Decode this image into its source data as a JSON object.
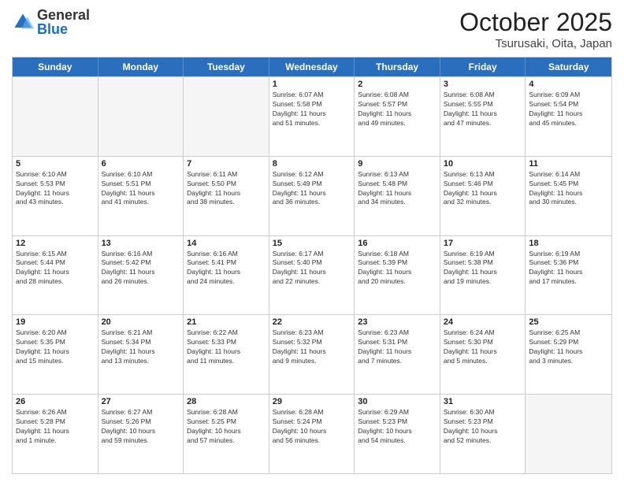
{
  "logo": {
    "general": "General",
    "blue": "Blue"
  },
  "title": "October 2025",
  "location": "Tsurusaki, Oita, Japan",
  "days": [
    "Sunday",
    "Monday",
    "Tuesday",
    "Wednesday",
    "Thursday",
    "Friday",
    "Saturday"
  ],
  "weeks": [
    [
      {
        "day": "",
        "info": ""
      },
      {
        "day": "",
        "info": ""
      },
      {
        "day": "",
        "info": ""
      },
      {
        "day": "1",
        "info": "Sunrise: 6:07 AM\nSunset: 5:58 PM\nDaylight: 11 hours\nand 51 minutes."
      },
      {
        "day": "2",
        "info": "Sunrise: 6:08 AM\nSunset: 5:57 PM\nDaylight: 11 hours\nand 49 minutes."
      },
      {
        "day": "3",
        "info": "Sunrise: 6:08 AM\nSunset: 5:55 PM\nDaylight: 11 hours\nand 47 minutes."
      },
      {
        "day": "4",
        "info": "Sunrise: 6:09 AM\nSunset: 5:54 PM\nDaylight: 11 hours\nand 45 minutes."
      }
    ],
    [
      {
        "day": "5",
        "info": "Sunrise: 6:10 AM\nSunset: 5:53 PM\nDaylight: 11 hours\nand 43 minutes."
      },
      {
        "day": "6",
        "info": "Sunrise: 6:10 AM\nSunset: 5:51 PM\nDaylight: 11 hours\nand 41 minutes."
      },
      {
        "day": "7",
        "info": "Sunrise: 6:11 AM\nSunset: 5:50 PM\nDaylight: 11 hours\nand 38 minutes."
      },
      {
        "day": "8",
        "info": "Sunrise: 6:12 AM\nSunset: 5:49 PM\nDaylight: 11 hours\nand 36 minutes."
      },
      {
        "day": "9",
        "info": "Sunrise: 6:13 AM\nSunset: 5:48 PM\nDaylight: 11 hours\nand 34 minutes."
      },
      {
        "day": "10",
        "info": "Sunrise: 6:13 AM\nSunset: 5:46 PM\nDaylight: 11 hours\nand 32 minutes."
      },
      {
        "day": "11",
        "info": "Sunrise: 6:14 AM\nSunset: 5:45 PM\nDaylight: 11 hours\nand 30 minutes."
      }
    ],
    [
      {
        "day": "12",
        "info": "Sunrise: 6:15 AM\nSunset: 5:44 PM\nDaylight: 11 hours\nand 28 minutes."
      },
      {
        "day": "13",
        "info": "Sunrise: 6:16 AM\nSunset: 5:42 PM\nDaylight: 11 hours\nand 26 minutes."
      },
      {
        "day": "14",
        "info": "Sunrise: 6:16 AM\nSunset: 5:41 PM\nDaylight: 11 hours\nand 24 minutes."
      },
      {
        "day": "15",
        "info": "Sunrise: 6:17 AM\nSunset: 5:40 PM\nDaylight: 11 hours\nand 22 minutes."
      },
      {
        "day": "16",
        "info": "Sunrise: 6:18 AM\nSunset: 5:39 PM\nDaylight: 11 hours\nand 20 minutes."
      },
      {
        "day": "17",
        "info": "Sunrise: 6:19 AM\nSunset: 5:38 PM\nDaylight: 11 hours\nand 19 minutes."
      },
      {
        "day": "18",
        "info": "Sunrise: 6:19 AM\nSunset: 5:36 PM\nDaylight: 11 hours\nand 17 minutes."
      }
    ],
    [
      {
        "day": "19",
        "info": "Sunrise: 6:20 AM\nSunset: 5:35 PM\nDaylight: 11 hours\nand 15 minutes."
      },
      {
        "day": "20",
        "info": "Sunrise: 6:21 AM\nSunset: 5:34 PM\nDaylight: 11 hours\nand 13 minutes."
      },
      {
        "day": "21",
        "info": "Sunrise: 6:22 AM\nSunset: 5:33 PM\nDaylight: 11 hours\nand 11 minutes."
      },
      {
        "day": "22",
        "info": "Sunrise: 6:23 AM\nSunset: 5:32 PM\nDaylight: 11 hours\nand 9 minutes."
      },
      {
        "day": "23",
        "info": "Sunrise: 6:23 AM\nSunset: 5:31 PM\nDaylight: 11 hours\nand 7 minutes."
      },
      {
        "day": "24",
        "info": "Sunrise: 6:24 AM\nSunset: 5:30 PM\nDaylight: 11 hours\nand 5 minutes."
      },
      {
        "day": "25",
        "info": "Sunrise: 6:25 AM\nSunset: 5:29 PM\nDaylight: 11 hours\nand 3 minutes."
      }
    ],
    [
      {
        "day": "26",
        "info": "Sunrise: 6:26 AM\nSunset: 5:28 PM\nDaylight: 11 hours\nand 1 minute."
      },
      {
        "day": "27",
        "info": "Sunrise: 6:27 AM\nSunset: 5:26 PM\nDaylight: 10 hours\nand 59 minutes."
      },
      {
        "day": "28",
        "info": "Sunrise: 6:28 AM\nSunset: 5:25 PM\nDaylight: 10 hours\nand 57 minutes."
      },
      {
        "day": "29",
        "info": "Sunrise: 6:28 AM\nSunset: 5:24 PM\nDaylight: 10 hours\nand 56 minutes."
      },
      {
        "day": "30",
        "info": "Sunrise: 6:29 AM\nSunset: 5:23 PM\nDaylight: 10 hours\nand 54 minutes."
      },
      {
        "day": "31",
        "info": "Sunrise: 6:30 AM\nSunset: 5:23 PM\nDaylight: 10 hours\nand 52 minutes."
      },
      {
        "day": "",
        "info": ""
      }
    ]
  ]
}
